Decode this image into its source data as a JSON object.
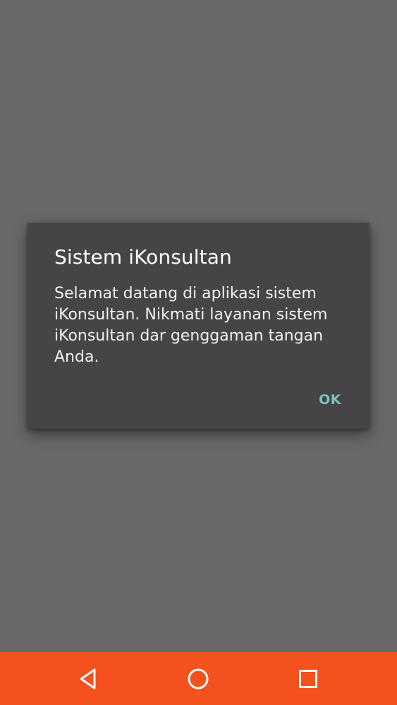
{
  "dialog": {
    "title": "Sistem iKonsultan",
    "message": "Selamat datang di aplikasi sistem iKonsultan. Nikmati layanan sistem iKonsultan dar genggaman tangan Anda.",
    "ok_label": "OK"
  },
  "navbar": {
    "color": "#f4511e",
    "buttons": [
      {
        "icon": "back-triangle-icon"
      },
      {
        "icon": "home-circle-icon"
      },
      {
        "icon": "recent-apps-square-icon"
      }
    ]
  },
  "colors": {
    "scrim": "#6a686b",
    "dialog_background": "#464447",
    "accent": "#7ac5bc"
  }
}
